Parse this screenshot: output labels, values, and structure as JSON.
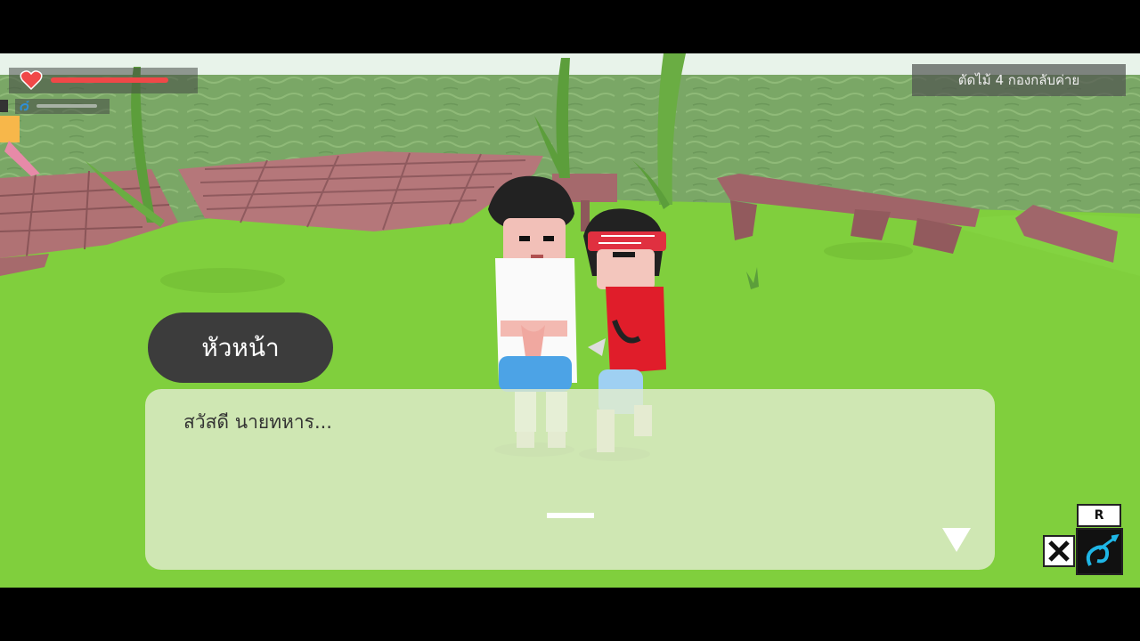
{
  "hud": {
    "health_icon": "heart-icon",
    "health_level": 0.92,
    "stamina_icon": "swirl-icon",
    "stamina_level": 0.0
  },
  "objective": {
    "text": "ตัดไม้ 4 กองกลับค่าย"
  },
  "dialogue": {
    "speaker": "หัวหน้า",
    "text": "สวัสดี นายทหาร...",
    "advance_icon": "down-triangle-icon"
  },
  "actions": {
    "skill_key": "R",
    "cancel_icon": "x-icon",
    "skill_icon": "swirl-icon"
  },
  "colors": {
    "health": "#f04848",
    "grass": "#7fce3c",
    "water": "#7da865",
    "accent_skill": "#1fb6e6",
    "dialog_bg": "#e1eccd",
    "name_tag_bg": "#3c3c3c"
  }
}
